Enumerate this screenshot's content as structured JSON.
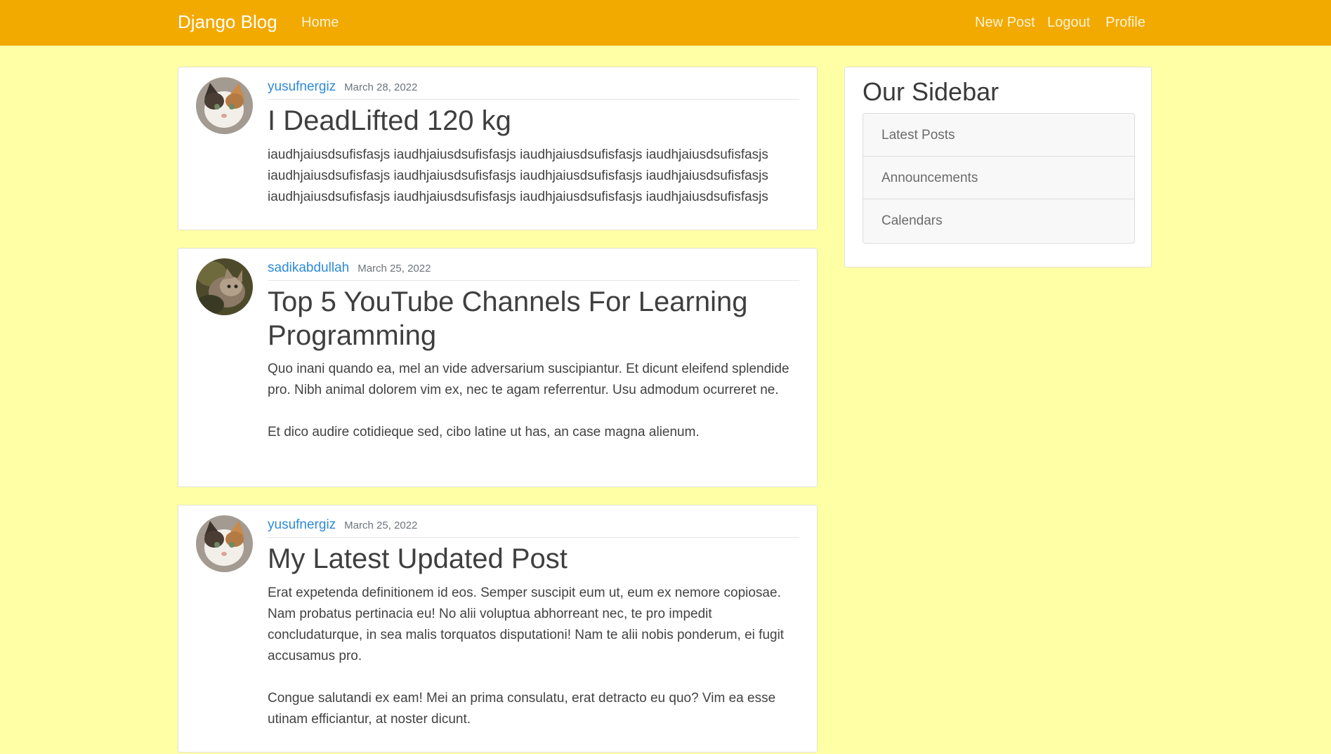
{
  "navbar": {
    "brand": "Django Blog",
    "home": "Home",
    "new_post": "New Post",
    "logout": "Logout",
    "profile": "Profile",
    "background": "#f2a900"
  },
  "posts": [
    {
      "author": "yusufnergiz",
      "date": "March 28, 2022",
      "title": "I DeadLifted 120 kg",
      "content": "iaudhjaiusdsufisfasjs iaudhjaiusdsufisfasjs iaudhjaiusdsufisfasjs iaudhjaiusdsufisfasjs iaudhjaiusdsufisfasjs iaudhjaiusdsufisfasjs iaudhjaiusdsufisfasjs iaudhjaiusdsufisfasjs iaudhjaiusdsufisfasjs iaudhjaiusdsufisfasjs iaudhjaiusdsufisfasjs iaudhjaiusdsufisfasjs"
    },
    {
      "author": "sadikabdullah",
      "date": "March 25, 2022",
      "title": "Top 5 YouTube Channels For Learning Programming",
      "content": "Quo inani quando ea, mel an vide adversarium suscipiantur. Et dicunt eleifend splendide pro. Nibh animal dolorem vim ex, nec te agam referrentur. Usu admodum ocurreret ne.\n\nEt dico audire cotidieque sed, cibo latine ut has, an case magna alienum."
    },
    {
      "author": "yusufnergiz",
      "date": "March 25, 2022",
      "title": "My Latest Updated Post",
      "content": "Erat expetenda definitionem id eos. Semper suscipit eum ut, eum ex nemore copiosae. Nam probatus pertinacia eu! No alii voluptua abhorreant nec, te pro impedit concludaturque, in sea malis torquatos disputationi! Nam te alii nobis ponderum, ei fugit accusamus pro.\n\nCongue salutandi ex eam! Mei an prima consulatu, erat detracto eu quo? Vim ea esse utinam efficiantur, at noster dicunt."
    }
  ],
  "sidebar": {
    "title": "Our Sidebar",
    "items": [
      "Latest Posts",
      "Announcements",
      "Calendars"
    ]
  },
  "colors": {
    "page_background": "#ffffa6",
    "author_link": "#2e8ad8"
  }
}
